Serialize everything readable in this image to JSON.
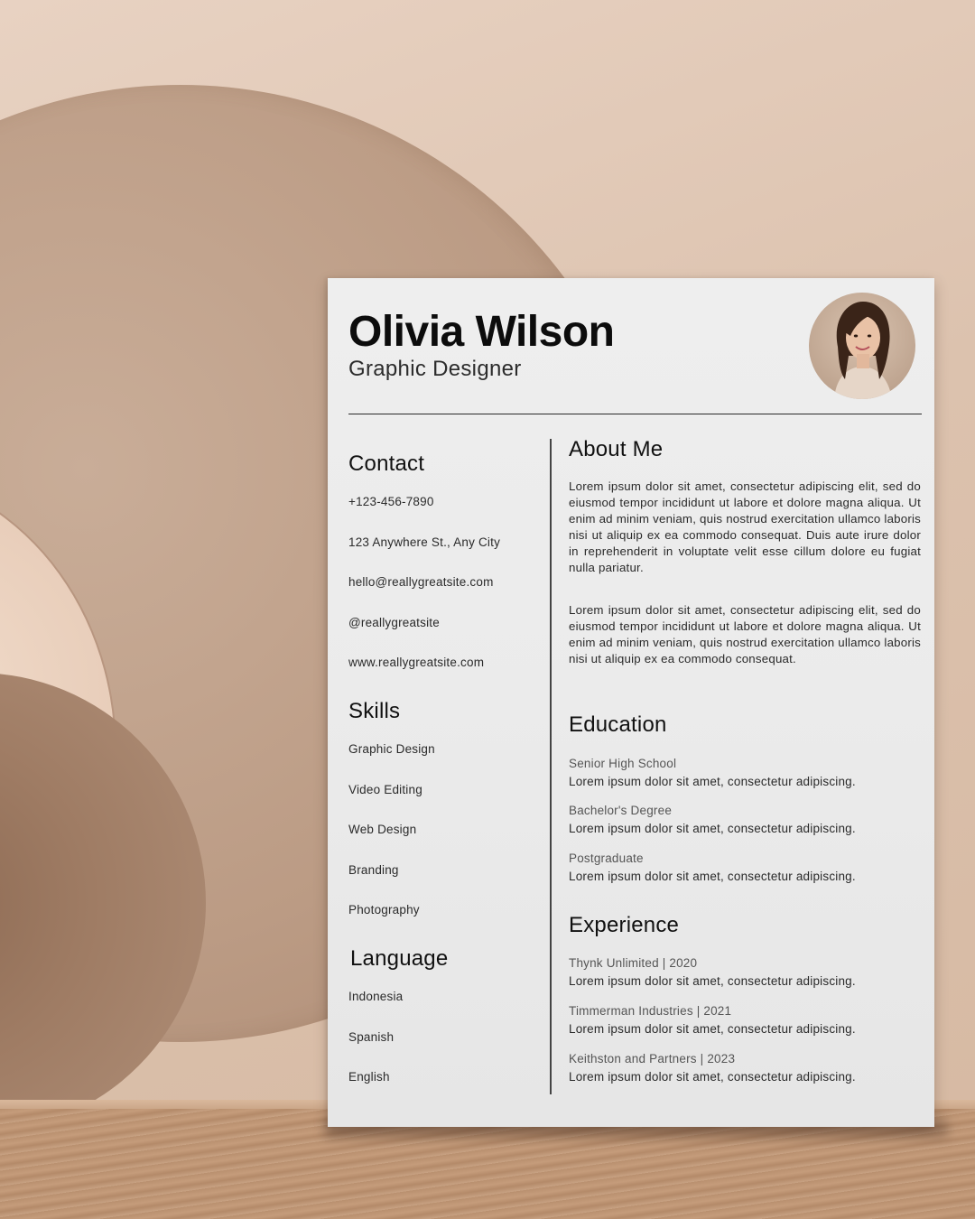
{
  "resume": {
    "name": "Olivia Wilson",
    "title": "Graphic Designer",
    "contact": {
      "heading": "Contact",
      "items": [
        "+123-456-7890",
        "123 Anywhere St., Any City",
        "hello@reallygreatsite.com",
        "@reallygreatsite",
        "www.reallygreatsite.com"
      ]
    },
    "skills": {
      "heading": "Skills",
      "items": [
        "Graphic Design",
        "Video Editing",
        "Web Design",
        "Branding",
        "Photography"
      ]
    },
    "language": {
      "heading": "Language",
      "items": [
        "Indonesia",
        "Spanish",
        "English"
      ]
    },
    "about": {
      "heading": "About Me",
      "paragraphs": [
        "Lorem ipsum dolor sit amet, consectetur adipiscing elit, sed do eiusmod tempor incididunt ut labore et dolore magna aliqua. Ut enim ad minim veniam, quis nostrud exercitation ullamco laboris nisi ut aliquip ex ea commodo consequat. Duis aute irure dolor in reprehenderit in voluptate velit esse cillum dolore eu fugiat nulla pariatur.",
        "Lorem ipsum dolor sit amet, consectetur adipiscing elit, sed do eiusmod tempor incididunt ut labore et dolore magna aliqua. Ut enim ad minim veniam, quis nostrud exercitation ullamco laboris nisi ut aliquip ex ea commodo consequat."
      ]
    },
    "education": {
      "heading": "Education",
      "entries": [
        {
          "title": "Senior High School",
          "desc": "Lorem ipsum dolor sit amet, consectetur adipiscing."
        },
        {
          "title": "Bachelor's Degree",
          "desc": "Lorem ipsum dolor sit amet, consectetur adipiscing."
        },
        {
          "title": "Postgraduate",
          "desc": "Lorem ipsum dolor sit amet, consectetur adipiscing."
        }
      ]
    },
    "experience": {
      "heading": "Experience",
      "entries": [
        {
          "title": "Thynk Unlimited | 2020",
          "desc": "Lorem ipsum dolor sit amet, consectetur adipiscing."
        },
        {
          "title": "Timmerman Industries | 2021",
          "desc": "Lorem ipsum dolor sit amet, consectetur adipiscing."
        },
        {
          "title": "Keithston and Partners | 2023",
          "desc": "Lorem ipsum dolor sit amet, consectetur adipiscing."
        }
      ]
    }
  },
  "colors": {
    "background": "#dcc2ae",
    "paper": "#ececec",
    "text": "#111111"
  }
}
